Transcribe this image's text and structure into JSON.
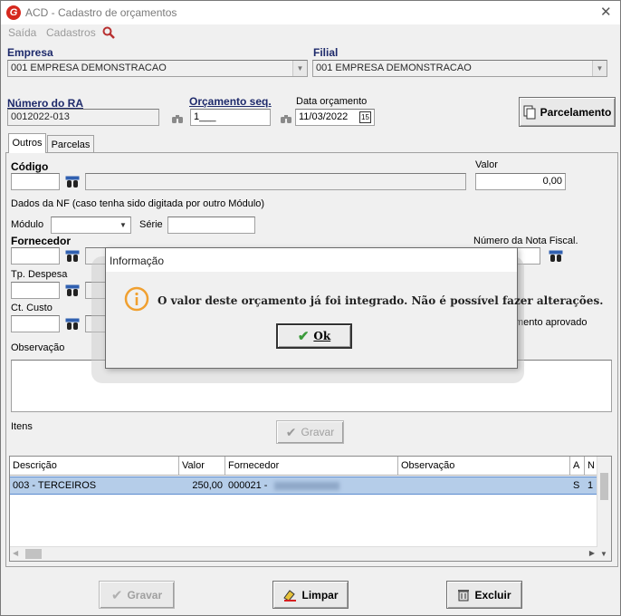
{
  "window": {
    "title": "ACD - Cadastro de orçamentos",
    "logo_letter": "G"
  },
  "menu": {
    "items": [
      "Saída",
      "Cadastros"
    ]
  },
  "empresa": {
    "label": "Empresa",
    "value": "001 EMPRESA DEMONSTRACAO"
  },
  "filial": {
    "label": "Filial",
    "value": "001 EMPRESA DEMONSTRACAO"
  },
  "numero_ra": {
    "label": "Número do RA",
    "value": "0012022-013"
  },
  "orcamento_seq": {
    "label": "Orçamento seq.",
    "value": "1___"
  },
  "data_orcamento": {
    "label": "Data orçamento",
    "value": "11/03/2022",
    "calendar_icon_text": "15"
  },
  "parcelamento_button": "Parcelamento",
  "tabs": [
    "Outros",
    "Parcelas"
  ],
  "codigo": {
    "label": "Código",
    "value": ""
  },
  "valor": {
    "label": "Valor",
    "value": "0,00"
  },
  "nf_note": "Dados da NF (caso tenha sido digitada por outro Módulo)",
  "modulo_label": "Módulo",
  "serie_label": "Série",
  "fornecedor_label": "Fornecedor",
  "numero_nota_label": "Número da Nota Fiscal.",
  "tp_despesa_label": "Tp. Despesa",
  "ct_custo_label": "Ct. Custo",
  "orcamento_aprovado_text": "mento aprovado",
  "observacao_label": "Observação",
  "itens_label": "Itens",
  "gravar_inner_label": "Gravar",
  "grid": {
    "columns": [
      "Descrição",
      "Valor",
      "Fornecedor",
      "Observação",
      "A",
      "N"
    ],
    "rows": [
      {
        "descricao": "003 - TERCEIROS",
        "valor": "250,00",
        "fornecedor": "000021 -",
        "observacao": "",
        "a": "S",
        "n": "1"
      }
    ]
  },
  "footer": {
    "gravar": "Gravar",
    "limpar": "Limpar",
    "excluir": "Excluir"
  },
  "dialog": {
    "title": "Informação",
    "message": "O valor deste orçamento já foi integrado. Não é possível fazer alterações.",
    "ok_label": "Ok"
  },
  "colors": {
    "label_blue": "#1e2a6b",
    "selection": "#b5cde9",
    "info_orange": "#f0a030",
    "check_green": "#3a9a3a"
  }
}
